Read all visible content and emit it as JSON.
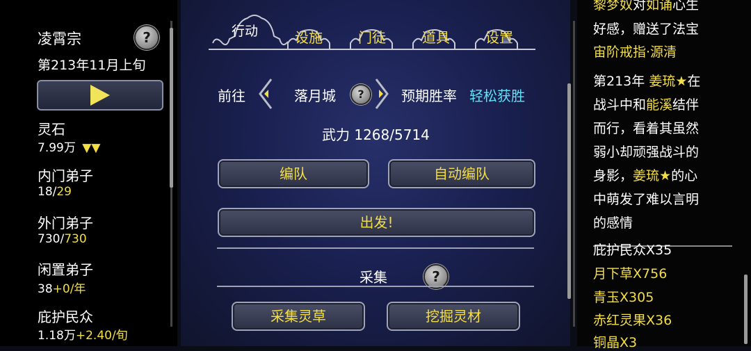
{
  "left": {
    "sect_name": "凌霄宗",
    "date": "第213年11月上旬",
    "help": "?",
    "stats": [
      {
        "label": "灵石",
        "value_main": "7.99万",
        "value_extra": "▼▼"
      },
      {
        "label": "内门弟子",
        "value_main": "18/",
        "value_extra": "29"
      },
      {
        "label": "外门弟子",
        "value_main": "730/",
        "value_extra": "730"
      },
      {
        "label": "闲置弟子",
        "value_main": "38",
        "value_extra": "+0/年"
      },
      {
        "label": "庇护民众",
        "value_main": "1.18万",
        "value_extra": "+2.40/旬"
      }
    ]
  },
  "tabs": {
    "active": "行动",
    "items": [
      "设施",
      "门徒",
      "道具",
      "设置"
    ]
  },
  "action": {
    "goto_label": "前往",
    "destination": "落月城",
    "help": "?",
    "win_rate_label": "预期胜率",
    "win_rate_value": "轻松获胜",
    "power": "武力 1268/5714",
    "formation_button": "编队",
    "auto_formation_button": "自动编队",
    "depart_button": "出发!",
    "gather_label": "采集",
    "gather_herbs_button": "采集灵草",
    "mine_button": "挖掘灵材"
  },
  "log": {
    "lines": [
      [
        {
          "t": "黎梦奴",
          "c": "y"
        },
        {
          "t": "对",
          "c": "w"
        },
        {
          "t": "如诵",
          "c": "y"
        },
        {
          "t": "心生",
          "c": "w"
        }
      ],
      [
        {
          "t": "好感，赠送了法宝",
          "c": "w"
        }
      ],
      [
        {
          "t": "宙阶戒指·源清",
          "c": "y"
        }
      ],
      [
        {
          "t": "第213年 ",
          "c": "w"
        },
        {
          "t": "姜琉★",
          "c": "y"
        },
        {
          "t": "在",
          "c": "w"
        }
      ],
      [
        {
          "t": "战斗中和",
          "c": "w"
        },
        {
          "t": "能溪",
          "c": "y"
        },
        {
          "t": "结伴",
          "c": "w"
        }
      ],
      [
        {
          "t": "而行，看着其虽然",
          "c": "w"
        }
      ],
      [
        {
          "t": "弱小却顽强战斗的",
          "c": "w"
        }
      ],
      [
        {
          "t": "身影，",
          "c": "w"
        },
        {
          "t": "姜琉★",
          "c": "y"
        },
        {
          "t": "的心",
          "c": "w"
        }
      ],
      [
        {
          "t": "中萌发了难以言明",
          "c": "w"
        }
      ],
      [
        {
          "t": "的感情",
          "c": "w"
        }
      ]
    ]
  },
  "resources": {
    "items": [
      {
        "text": "庇护民众X35",
        "color": "w"
      },
      {
        "text": "月下草X756",
        "color": "y"
      },
      {
        "text": "青玉X305",
        "color": "y"
      },
      {
        "text": "赤红灵果X36",
        "color": "y"
      },
      {
        "text": "铜晶X3",
        "color": "y"
      }
    ]
  },
  "colors": {
    "yellow": "#f4de45",
    "cyan": "#5de3f6",
    "white": "#ffffff"
  }
}
